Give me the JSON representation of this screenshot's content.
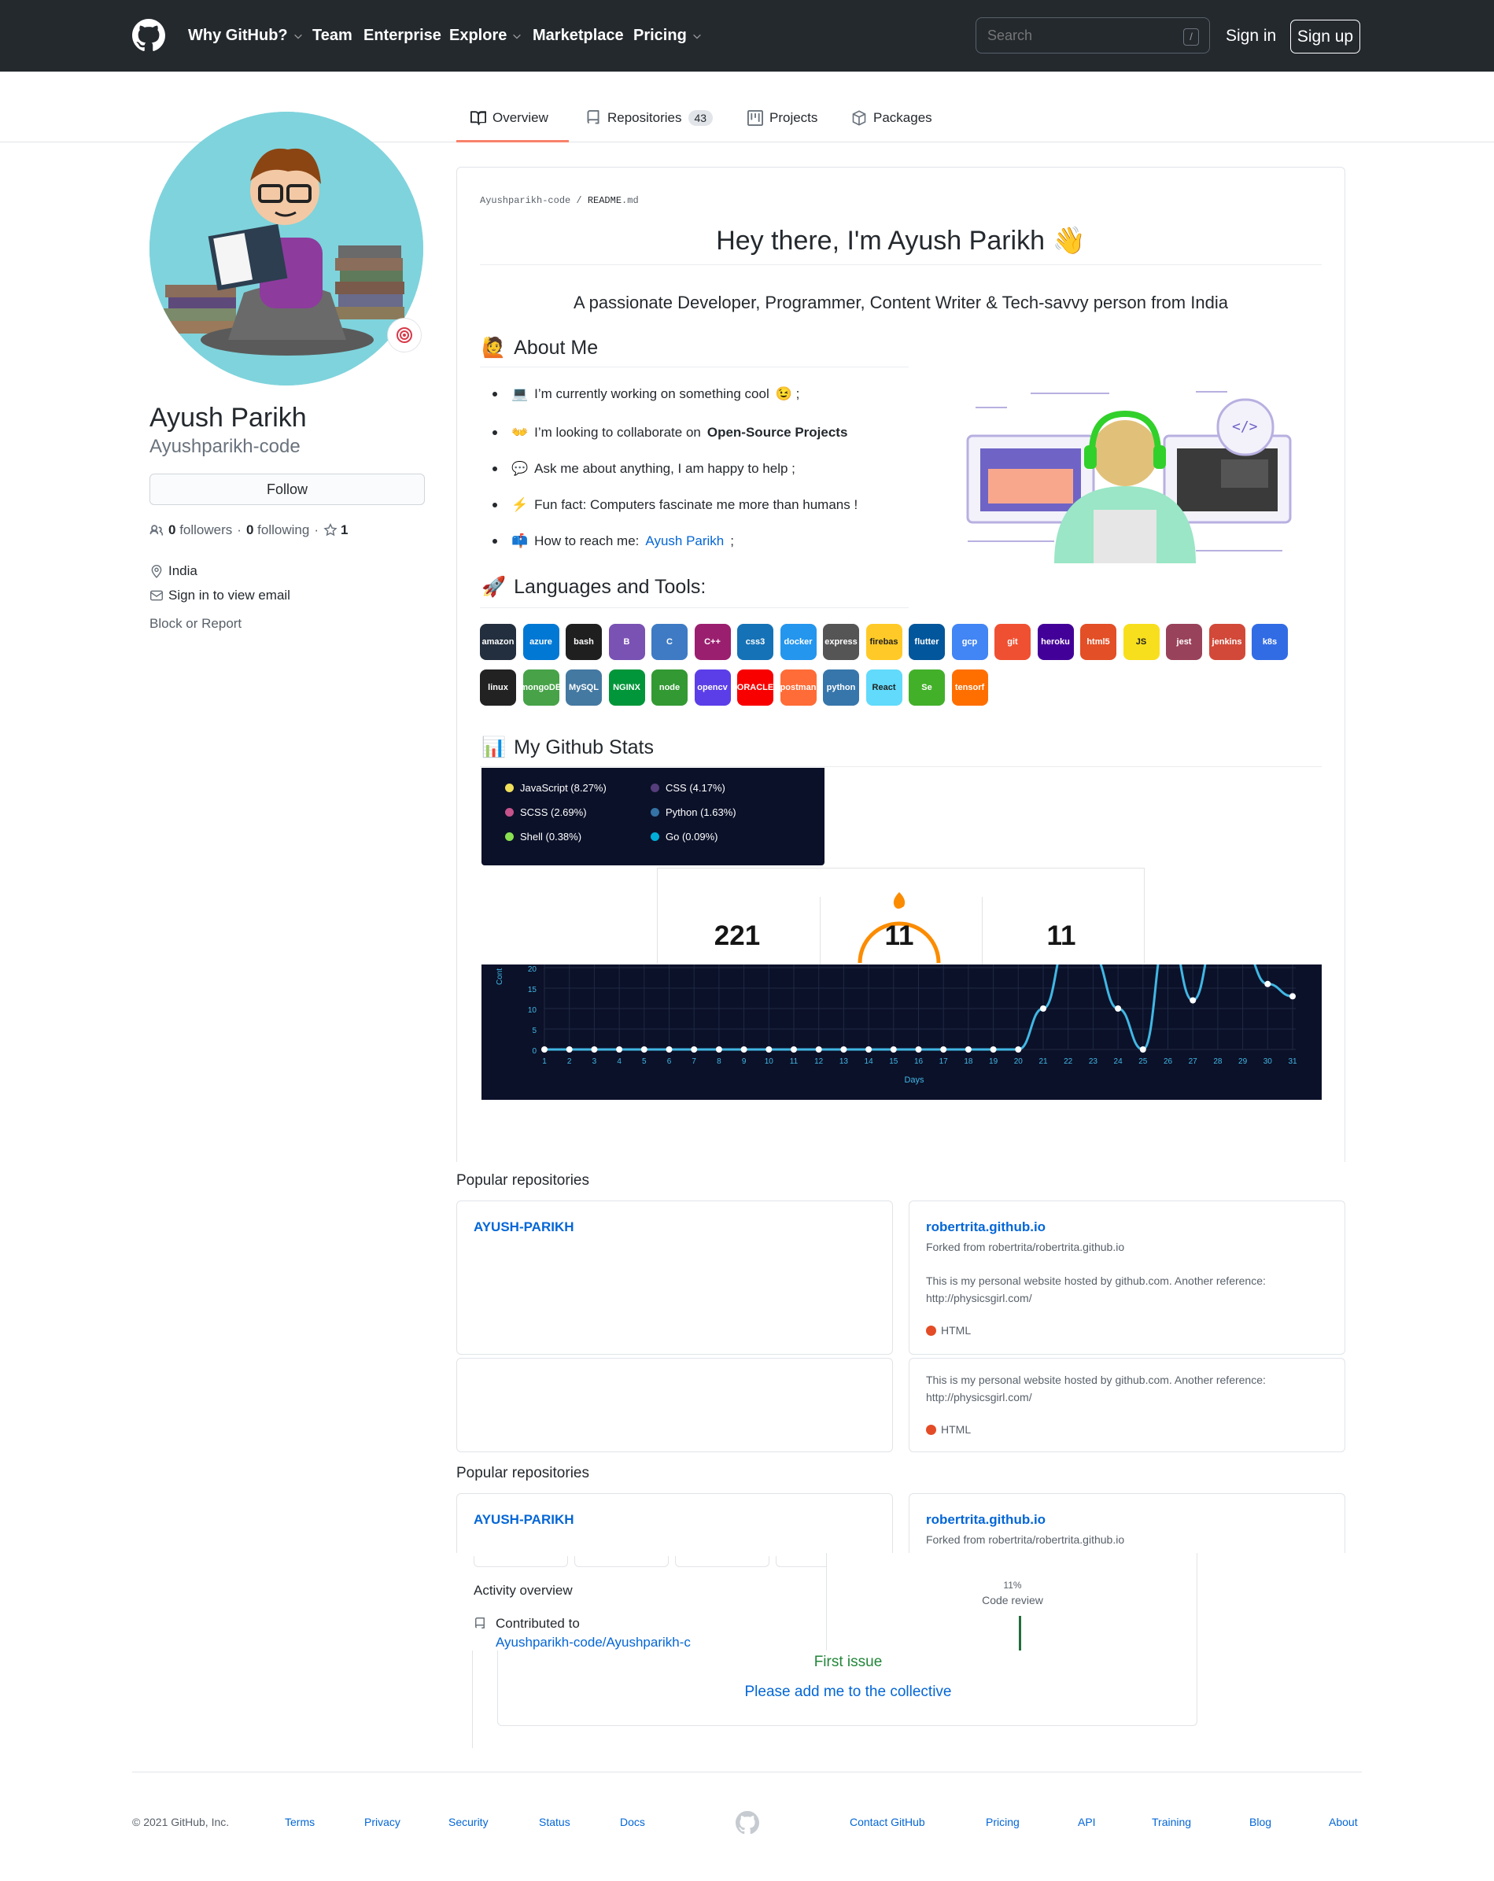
{
  "header": {
    "nav": [
      {
        "label": "Why GitHub?",
        "chevron": true
      },
      {
        "label": "Team",
        "chevron": false
      },
      {
        "label": "Enterprise",
        "chevron": false
      },
      {
        "label": "Explore",
        "chevron": true
      },
      {
        "label": "Marketplace",
        "chevron": false
      },
      {
        "label": "Pricing",
        "chevron": true
      }
    ],
    "search_placeholder": "Search",
    "search_shortcut": "/",
    "sign_in": "Sign in",
    "sign_up": "Sign up"
  },
  "tabs": [
    {
      "label": "Overview",
      "icon": "book-icon",
      "active": true
    },
    {
      "label": "Repositories",
      "icon": "repo-icon",
      "count": "43"
    },
    {
      "label": "Projects",
      "icon": "project-icon"
    },
    {
      "label": "Packages",
      "icon": "package-icon"
    }
  ],
  "profile": {
    "full_name": "Ayush Parikh",
    "username": "Ayushparikh-code",
    "follow": "Follow",
    "followers_count": "0",
    "followers_label": "followers",
    "following_count": "0",
    "following_label": "following",
    "stars": "1",
    "location": "India",
    "email": "Sign in to view email",
    "block": "Block or Report"
  },
  "readme": {
    "breadcrumb_user": "Ayushparikh-code",
    "breadcrumb_sep": " / ",
    "breadcrumb_file": "README",
    "breadcrumb_ext": ".md",
    "title": "Hey there, I'm Ayush Parikh",
    "subtitle": "A passionate Developer, Programmer, Content Writer & Tech-savvy person from India",
    "about_heading": "About Me",
    "about": [
      {
        "emoji": "💻",
        "text": "I’m currently working on something cool",
        "suffix": "😉 ;"
      },
      {
        "emoji": "👐",
        "text": "I’m looking to collaborate on",
        "bold": "Open-Source Projects"
      },
      {
        "emoji": "💬",
        "text": "Ask me about anything, I am happy to help ;"
      },
      {
        "emoji": "⚡",
        "text": "Fun fact: Computers fascinate me more than humans !"
      },
      {
        "emoji": "📫",
        "text": "How to reach me:",
        "link": "Ayush Parikh",
        "suffix": ";"
      }
    ],
    "tools_heading": "Languages and Tools:",
    "tools_row1": [
      "amazon",
      "azure",
      "bash",
      "B",
      "C",
      "C++",
      "css3",
      "docker",
      "express",
      "firebase",
      "flutter",
      "gcp",
      "git",
      "heroku",
      "html5",
      "JS",
      "jest",
      "jenkins",
      "k8s"
    ],
    "tools_row2": [
      "linux",
      "mongoDB",
      "MySQL",
      "NGINX",
      "node",
      "opencv",
      "ORACLE",
      "postman",
      "python",
      "React",
      "Se",
      "tensorflow"
    ],
    "stats_heading": "My Github Stats"
  },
  "languages": [
    {
      "name": "JavaScript (8.27%)",
      "color": "#f1e05a"
    },
    {
      "name": "CSS (4.17%)",
      "color": "#563d7c"
    },
    {
      "name": "SCSS (2.69%)",
      "color": "#c6538c"
    },
    {
      "name": "Python (1.63%)",
      "color": "#3572A5"
    },
    {
      "name": "Shell (0.38%)",
      "color": "#89e051"
    },
    {
      "name": "Go (0.09%)",
      "color": "#00ADD8"
    }
  ],
  "streak": {
    "total": "221",
    "current": "11",
    "longest": "11"
  },
  "chart_data": {
    "type": "line",
    "x": [
      1,
      2,
      3,
      4,
      5,
      6,
      7,
      8,
      9,
      10,
      11,
      12,
      13,
      14,
      15,
      16,
      17,
      18,
      19,
      20,
      21,
      22,
      23,
      24,
      25,
      26,
      27,
      28,
      29,
      30,
      31
    ],
    "values": [
      0,
      0,
      0,
      0,
      0,
      0,
      0,
      0,
      0,
      0,
      0,
      0,
      0,
      0,
      0,
      0,
      0,
      0,
      0,
      0,
      10,
      27,
      23,
      10,
      0,
      30,
      12,
      30,
      25,
      16,
      13
    ],
    "xlabel": "Days",
    "ylabel": "Cont",
    "yticks": [
      "20",
      "15",
      "10",
      "5",
      "0"
    ],
    "ylim": [
      0,
      20
    ],
    "grid": true,
    "line_color": "#41b7e4"
  },
  "popular1": {
    "title": "Popular repositories",
    "left_name": "AYUSH-PARIKH",
    "right_name": "robertrita.github.io",
    "right_fork": "Forked from robertrita/robertrita.github.io",
    "right_desc": "This is my personal website hosted by github.com. Another reference: http://physicsgirl.com/",
    "lang": "HTML",
    "second_desc": "This is my personal website hosted by github.com. Another reference: http://physicsgirl.com/",
    "second_lang": "HTML"
  },
  "popular2": {
    "title": "Popular repositories",
    "left_name": "AYUSH-PARIKH",
    "right_name": "robertrita.github.io",
    "right_fork": "Forked from robertrita/robertrita.github.io"
  },
  "activity": {
    "title": "Activity overview",
    "contributed": "Contributed to",
    "repo_link": "Ayushparikh-code/Ayushparikh-c",
    "code_review_pct": "11%",
    "code_review": "Code review",
    "first_issue": "First issue",
    "issue_title": "Please add me to the collective"
  },
  "footer": {
    "copyright": "© 2021 GitHub, Inc.",
    "left_links": [
      "Terms",
      "Privacy",
      "Security",
      "Status",
      "Docs"
    ],
    "right_links": [
      "Contact GitHub",
      "Pricing",
      "API",
      "Training",
      "Blog",
      "About"
    ]
  }
}
